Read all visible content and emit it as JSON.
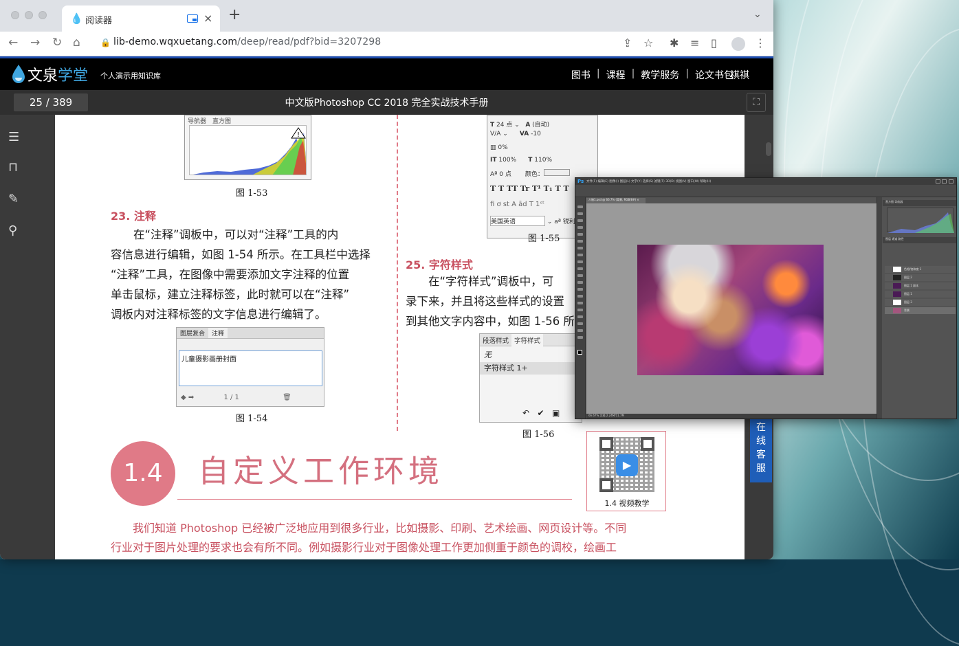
{
  "browser": {
    "tab_title": "阅读器",
    "tab_close": "×",
    "new_tab": "+",
    "tab_menu": "⌄",
    "url_host": "lib-demo.wqxuetang.com",
    "url_path": "/deep/read/pdf?bid=3207298",
    "icons": [
      "back-icon",
      "forward-icon",
      "reload-icon",
      "home-icon",
      "lock-icon",
      "share-icon",
      "star-icon",
      "extensions-icon",
      "reading-list-icon",
      "sidepanel-icon",
      "profile-icon",
      "menu-icon"
    ]
  },
  "site": {
    "logo_part1": "文泉",
    "logo_part2": "学堂",
    "logo_sub": "个人演示用知识库",
    "nav": [
      "图书",
      "课程",
      "教学服务",
      "论文书包"
    ],
    "nav_sep": "|",
    "username": "祺祺"
  },
  "reader": {
    "page_indicator": "25 / 389",
    "book_title": "中文版Photoshop CC 2018 完全实战技术手册",
    "fullscreen_icon": "⛶",
    "rail_icons": [
      "toc-icon",
      "bookmark-icon",
      "notes-icon",
      "search-icon"
    ]
  },
  "page": {
    "fig53_caption": "图 1-53",
    "fig53_tabs": [
      "导航器",
      "直方图"
    ],
    "sec23_title": "23. 注释",
    "sec23_lines": [
      "　　在“注释”调板中，可以对“注释”工具的内",
      "容信息进行编辑，如图 1-54 所示。在工具栏中选择",
      "“注释”工具，在图像中需要添加文字注释的位置",
      "单击鼠标，建立注释标签，此时就可以在“注释”",
      "调板内对注释标签的文字信息进行编辑了。"
    ],
    "fig54": {
      "tabs": [
        "图层复合",
        "注释"
      ],
      "content": "儿童摄影画册封面",
      "pager": "1 / 1",
      "caption": "图 1-54"
    },
    "fig55": {
      "size": "24 点",
      "leading": "(自动)",
      "tracking": "-10",
      "scale_pct": "0%",
      "vscale": "100%",
      "hscale": "110%",
      "baseline": "0 点",
      "color_label": "颜色：",
      "language": "美国英语",
      "aa_label": "锐利",
      "style_row": "T  T  TT  Tr  T¹  T₁  T  T",
      "ot_row": "fi  ơ  st  A  ād  T  1ˢᵗ",
      "caption": "图 1-55"
    },
    "sec25_title": "25. 字符样式",
    "sec25_lines": [
      "　　在“字符样式”调板中，可",
      "录下来，并且将这些样式的设置",
      "到其他文字内容中，如图 1-56 所"
    ],
    "fig56": {
      "tabs": [
        "段落样式",
        "字符样式"
      ],
      "items": [
        "无",
        "字符样式 1+"
      ],
      "caption": "图 1-56"
    },
    "sec14_number": "1.4",
    "sec14_title": "自定义工作环境",
    "qr_label": "1.4  视频教学",
    "bottom_lines": [
      "　　我们知道 Photoshop 已经被广泛地应用到很多行业，比如摄影、印刷、艺术绘画、网页设计等。不同",
      "行业对于图片处理的要求也会有所不同。例如摄影行业对于图像处理工作更加侧重于颜色的调校，绘画工"
    ]
  },
  "service": {
    "label": "在线客服"
  },
  "photoshop": {
    "logo": "Ps",
    "menus": "文件(F)  编辑(E)  图像(I)  图层(L)  文字(Y)  选择(S)  滤镜(T)  3D(D)  视图(V)  窗口(W)  帮助(H)",
    "doc_tab": "人物1.psd @ 66.7% (背景, RGB/8#) ×",
    "panel_tabs1": "直方图   导航器",
    "panel_tabs2": "图层   通道   路径",
    "status": "66.67%      文档:2.24M/11.7M",
    "layers": [
      "色相/饱和度 1",
      "图层 2",
      "图层 1 副本",
      "图层 1",
      "图层 3",
      "背景"
    ]
  }
}
